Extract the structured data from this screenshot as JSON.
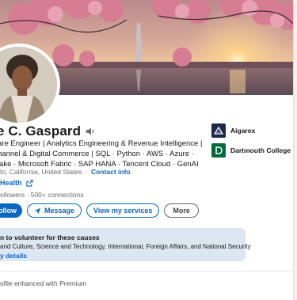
{
  "profile": {
    "name": "e C. Gaspard",
    "headline_lines": [
      "are Engineer | Analytics Engineering & Revenue Intelligence |",
      "hannel & Digital Commerce | SQL · Python · AWS · Azure ·",
      "lake · Microsoft Fabric · SAP HANA · Tencent Cloud · GenAI"
    ],
    "location": "to, California, United States",
    "contact_info": "Contact info",
    "website": "Health",
    "connections": "ollowers · 500+ connections"
  },
  "actions": {
    "follow": "ollow",
    "message": "Message",
    "services": "View my services",
    "more": "More"
  },
  "orgs": [
    {
      "name": "Aigarex",
      "icon": "aigarex-logo"
    },
    {
      "name": "Dartmouth College",
      "icon": "dartmouth-logo"
    }
  ],
  "volunteer": {
    "title": "n to volunteer for these causes",
    "causes": "and Culture, Science and Technology, International, Foreign Affairs, and National Security",
    "details": "y details"
  },
  "premium": "ofile enhanced with Premium",
  "colors": {
    "accent": "#0a66c2",
    "volunteer_bg": "#dde7f1",
    "dartmouth_green": "#00693e",
    "aigarex_navy": "#1b2a4a"
  }
}
